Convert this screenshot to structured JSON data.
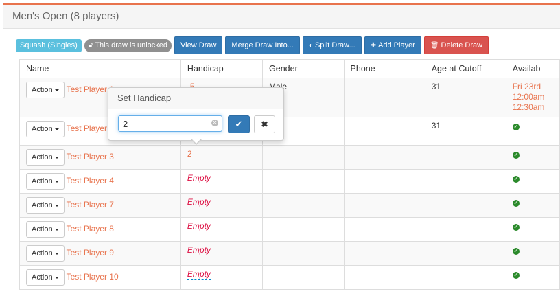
{
  "panel": {
    "title": "Men's Open (8 players)"
  },
  "toolbar": {
    "sport_label": "Squash (Singles)",
    "lock_label": "This draw is unlocked",
    "view_draw": "View Draw",
    "merge_draw": "Merge Draw Into...",
    "split_draw": "Split Draw...",
    "add_player": "Add Player",
    "delete_draw": "Delete Draw"
  },
  "table": {
    "headers": [
      "Name",
      "Handicap",
      "Gender",
      "Phone",
      "Age at Cutoff",
      "Availab"
    ],
    "action_label": "Action",
    "rows": [
      {
        "name": "Test Player 1",
        "handicap": "-5",
        "gender": "Male",
        "phone": "",
        "age": "31",
        "avail": [
          "Fri 23rd",
          "12:00am",
          "12:30am"
        ]
      },
      {
        "name": "Test Player",
        "handicap": "",
        "gender": "",
        "phone": "",
        "age": "31",
        "avail": []
      },
      {
        "name": "Test Player 3",
        "handicap": "2",
        "gender": "",
        "phone": "",
        "age": "",
        "avail": []
      },
      {
        "name": "Test Player 4",
        "handicap": "Empty",
        "gender": "",
        "phone": "",
        "age": "",
        "avail": []
      },
      {
        "name": "Test Player 7",
        "handicap": "Empty",
        "gender": "",
        "phone": "",
        "age": "",
        "avail": []
      },
      {
        "name": "Test Player 8",
        "handicap": "Empty",
        "gender": "",
        "phone": "",
        "age": "",
        "avail": []
      },
      {
        "name": "Test Player 9",
        "handicap": "Empty",
        "gender": "",
        "phone": "",
        "age": "",
        "avail": []
      },
      {
        "name": "Test Player 10",
        "handicap": "Empty",
        "gender": "",
        "phone": "",
        "age": "",
        "avail": []
      }
    ]
  },
  "popover": {
    "title": "Set Handicap",
    "input_value": "2"
  },
  "colors": {
    "accent": "#e8734d",
    "primary": "#337ab7",
    "danger": "#d9534f",
    "info": "#5bc0de"
  }
}
